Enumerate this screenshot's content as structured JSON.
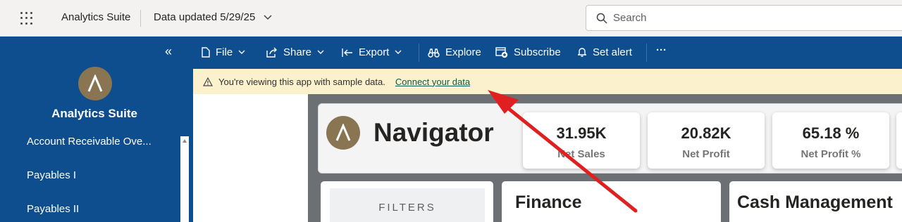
{
  "topbar": {
    "app_name": "Analytics Suite",
    "data_updated": "Data updated 5/29/25",
    "search_placeholder": "Search"
  },
  "sidebar": {
    "title": "Analytics Suite",
    "items": [
      {
        "label": "Account Receivable Ove..."
      },
      {
        "label": "Payables I"
      },
      {
        "label": "Payables II"
      }
    ]
  },
  "commandbar": {
    "file": "File",
    "share": "Share",
    "export": "Export",
    "explore": "Explore",
    "subscribe": "Subscribe",
    "set_alert": "Set alert",
    "more": "···"
  },
  "banner": {
    "message": "You're viewing this app with sample data.",
    "link": "Connect your data"
  },
  "report": {
    "title": "Navigator",
    "kpis": [
      {
        "value": "31.95K",
        "label": "Net Sales"
      },
      {
        "value": "20.82K",
        "label": "Net Profit"
      },
      {
        "value": "65.18 %",
        "label": "Net Profit %"
      }
    ],
    "filters_label": "FILTERS",
    "sections": [
      "Finance",
      "Cash Management"
    ]
  },
  "colors": {
    "sidebar": "#0e4d8e",
    "banner": "#fbf1cd",
    "logo": "#8a7553",
    "annotation_arrow": "#e02020"
  }
}
